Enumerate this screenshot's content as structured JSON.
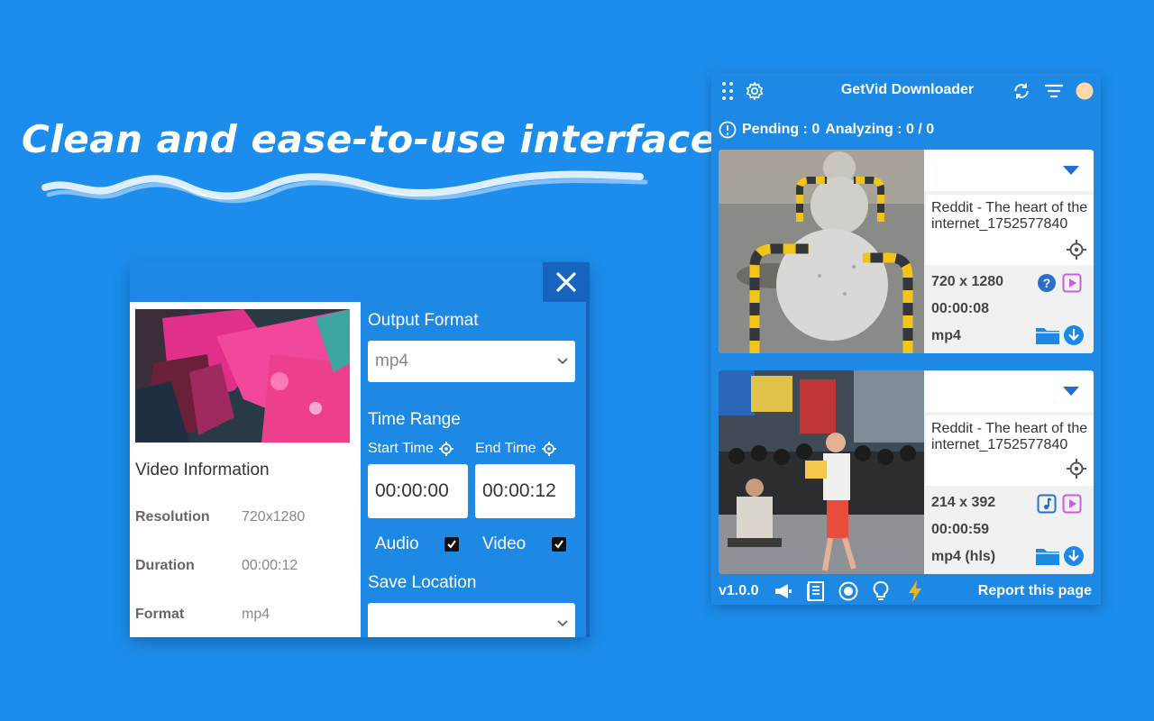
{
  "headline": "Clean and ease-to-use interface",
  "colors": {
    "background": "#1c8ded",
    "panel_blue": "#1e88e5",
    "accent_dark": "#1565c0",
    "purple_play": "#c95de6",
    "orange_bolt": "#ffb300"
  },
  "converter": {
    "close_icon": "close-icon",
    "video_info": {
      "title": "Video Information",
      "rows": [
        {
          "label": "Resolution",
          "value": "720x1280"
        },
        {
          "label": "Duration",
          "value": "00:00:12"
        },
        {
          "label": "Format",
          "value": "mp4"
        }
      ]
    },
    "output_format": {
      "label": "Output Format",
      "selected": "mp4"
    },
    "time_range": {
      "label": "Time Range",
      "start_label": "Start Time",
      "end_label": "End Time",
      "start_value": "00:00:00",
      "end_value": "00:00:12"
    },
    "audio_label": "Audio",
    "video_label": "Video",
    "audio_checked": true,
    "video_checked": true,
    "save_location": {
      "label": "Save Location",
      "selected": ""
    }
  },
  "popup": {
    "title": "GetVid Downloader",
    "pending_text": "Pending : 0",
    "analyzing_text": "Analyzing : 0 / 0",
    "items": [
      {
        "title": "Reddit - The heart of the internet_1752577840",
        "resolution": "720 x 1280",
        "duration": "00:00:08",
        "format": "mp4",
        "type_icon": "help-icon"
      },
      {
        "title": "Reddit - The heart of the internet_1752577840",
        "resolution": "214 x 392",
        "duration": "00:00:59",
        "format": "mp4 (hls)",
        "type_icon": "music-note-icon"
      }
    ],
    "version": "v1.0.0",
    "report_label": "Report this page"
  }
}
